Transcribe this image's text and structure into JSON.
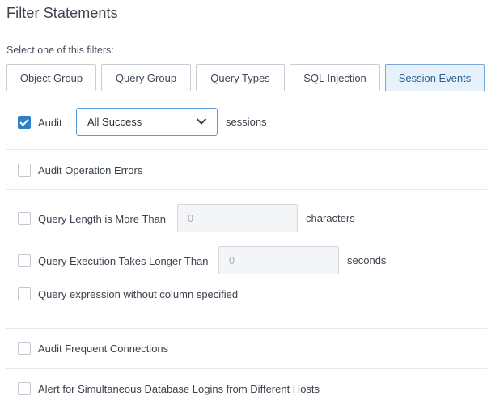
{
  "title": "Filter Statements",
  "subtitle": "Select one of this filters:",
  "tabs": [
    {
      "label": "Object Group"
    },
    {
      "label": "Query Group"
    },
    {
      "label": "Query Types"
    },
    {
      "label": "SQL Injection"
    },
    {
      "label": "Session Events",
      "active": true
    }
  ],
  "audit": {
    "label": "Audit",
    "checked": true,
    "select_value": "All Success",
    "suffix": "sessions"
  },
  "audit_operation_errors": {
    "label": "Audit Operation Errors",
    "checked": false
  },
  "query_length": {
    "label": "Query Length is More Than",
    "value": "0",
    "suffix": "characters",
    "checked": false
  },
  "query_execution": {
    "label": "Query Execution Takes Longer Than",
    "value": "0",
    "suffix": "seconds",
    "checked": false
  },
  "query_expression": {
    "label": "Query expression without column specified",
    "checked": false
  },
  "audit_frequent": {
    "label": "Audit Frequent Connections",
    "checked": false
  },
  "alert_simultaneous": {
    "label": "Alert for Simultaneous Database Logins from Different Hosts",
    "checked": false
  },
  "colors": {
    "accent": "#2d7fc7",
    "active_tab_bg": "#e7f1fb",
    "active_tab_border": "#7aa7d6"
  }
}
